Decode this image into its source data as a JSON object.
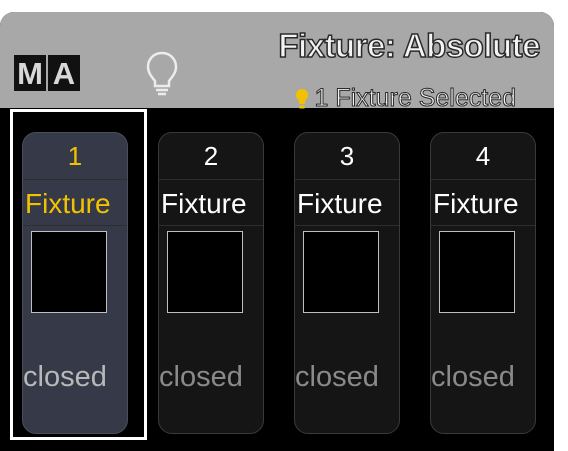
{
  "header": {
    "logo_letters": [
      "M",
      "A"
    ],
    "title": "Fixture: Absolute",
    "selection_text": "1 Fixture Selected",
    "bulb_icon": "lightbulb-icon",
    "selection_icon": "lightbulb-filled-icon"
  },
  "fixtures": [
    {
      "number": "1",
      "name": "Fixture",
      "state": "closed",
      "selected": true
    },
    {
      "number": "2",
      "name": "Fixture",
      "state": "closed",
      "selected": false
    },
    {
      "number": "3",
      "name": "Fixture",
      "state": "closed",
      "selected": false
    },
    {
      "number": "4",
      "name": "Fixture",
      "state": "closed",
      "selected": false
    }
  ],
  "colors": {
    "selected_text": "#f2c200",
    "header_background": "#a8a8a8",
    "selected_card": "#363a48"
  }
}
